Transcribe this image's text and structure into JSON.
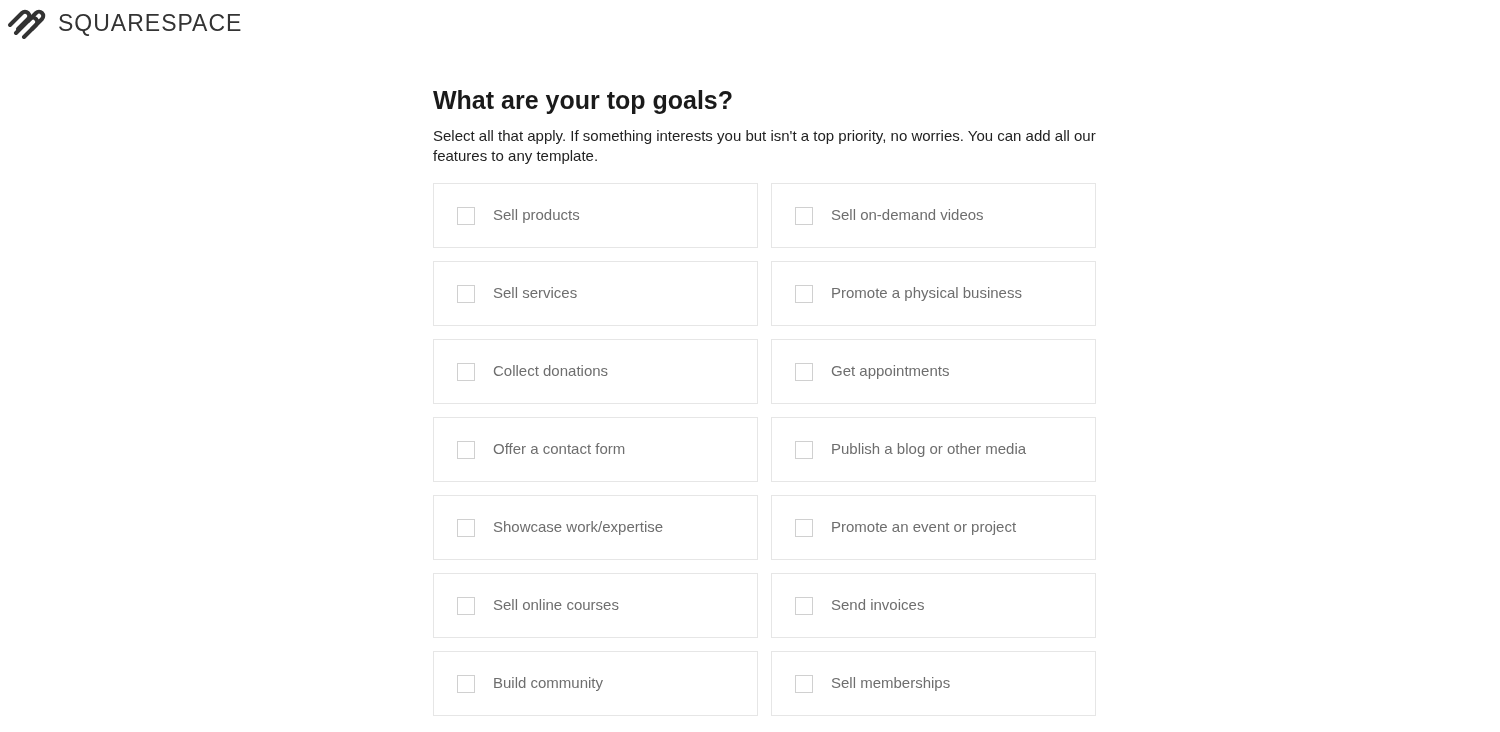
{
  "logo": {
    "text": "SQUARESPACE"
  },
  "title": "What are your top goals?",
  "description": "Select all that apply. If something interests you but isn't a top priority, no worries. You can add all our features to any template.",
  "goals": [
    {
      "label": "Sell products",
      "checked": false
    },
    {
      "label": "Sell on-demand videos",
      "checked": false
    },
    {
      "label": "Sell services",
      "checked": false
    },
    {
      "label": "Promote a physical business",
      "checked": false
    },
    {
      "label": "Collect donations",
      "checked": false
    },
    {
      "label": "Get appointments",
      "checked": false
    },
    {
      "label": "Offer a contact form",
      "checked": false
    },
    {
      "label": "Publish a blog or other media",
      "checked": false
    },
    {
      "label": "Showcase work/expertise",
      "checked": false
    },
    {
      "label": "Promote an event or project",
      "checked": false
    },
    {
      "label": "Sell online courses",
      "checked": false
    },
    {
      "label": "Send invoices",
      "checked": false
    },
    {
      "label": "Build community",
      "checked": false
    },
    {
      "label": "Sell memberships",
      "checked": false
    }
  ]
}
